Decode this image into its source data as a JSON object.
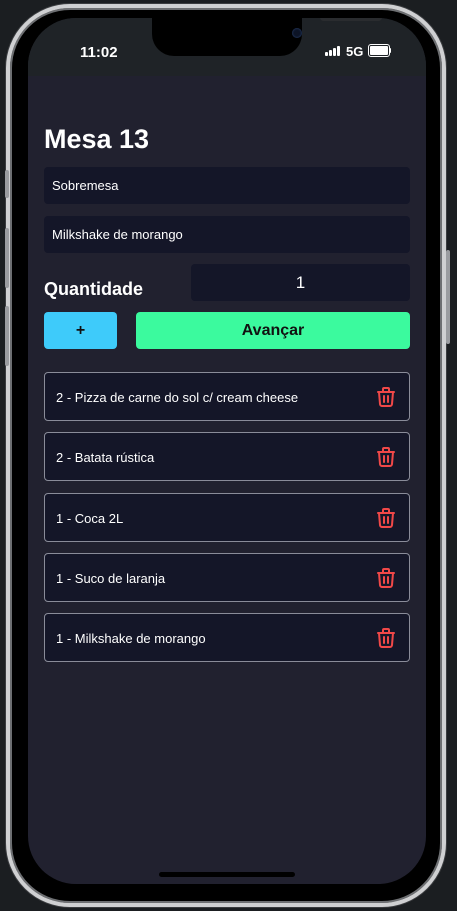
{
  "status_bar": {
    "time": "11:02",
    "network": "5G",
    "signal_icon": "signal-bars-icon",
    "battery_icon": "battery-icon",
    "battery_level": 1.0
  },
  "page": {
    "title": "Mesa 13"
  },
  "form": {
    "category_value": "Sobremesa",
    "product_value": "Milkshake de morango",
    "quantity_label": "Quantidade",
    "quantity_value": "1",
    "plus_label": "+",
    "advance_label": "Avançar"
  },
  "orders": [
    {
      "text": "2 - Pizza de carne do sol c/ cream cheese",
      "icon": "trash-icon"
    },
    {
      "text": "2 - Batata rústica",
      "icon": "trash-icon"
    },
    {
      "text": "1 - Coca 2L",
      "icon": "trash-icon"
    },
    {
      "text": "1 - Suco de laranja",
      "icon": "trash-icon"
    },
    {
      "text": "1 - Milkshake de morango",
      "icon": "trash-icon"
    }
  ],
  "colors": {
    "background": "#21212f",
    "field": "#141628",
    "plus_button": "#3ecbfa",
    "advance_button": "#3bfa9e",
    "trash": "#f04848"
  }
}
